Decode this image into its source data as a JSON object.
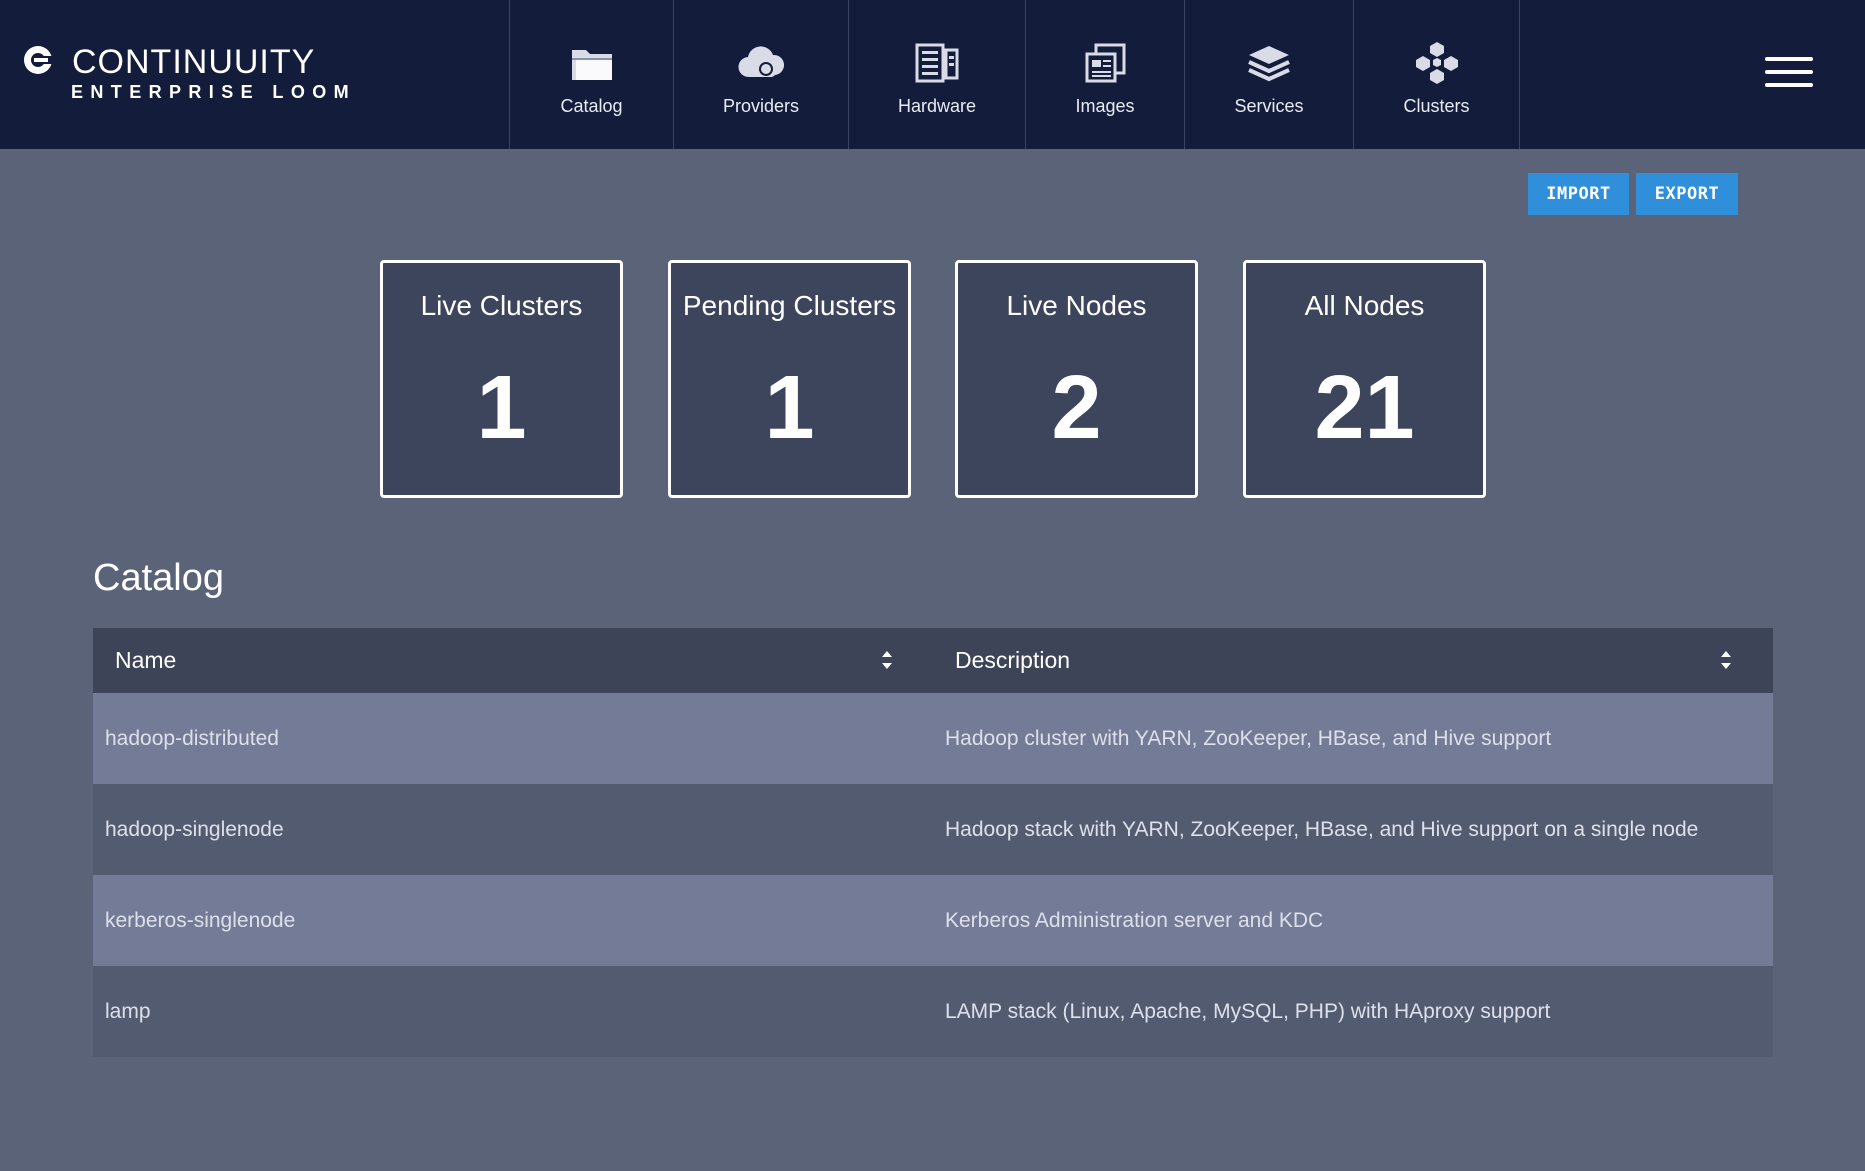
{
  "brand": {
    "name": "CONTINUUITY",
    "subtitle": "ENTERPRISE LOOM"
  },
  "nav": [
    {
      "label": "Catalog",
      "icon": "folder-icon"
    },
    {
      "label": "Providers",
      "icon": "cloud-icon"
    },
    {
      "label": "Hardware",
      "icon": "server-icon"
    },
    {
      "label": "Images",
      "icon": "images-icon"
    },
    {
      "label": "Services",
      "icon": "layers-icon"
    },
    {
      "label": "Clusters",
      "icon": "cubes-icon"
    }
  ],
  "menu": {
    "icon": "hamburger-menu-icon"
  },
  "actions": {
    "import_label": "IMPORT",
    "export_label": "EXPORT"
  },
  "stats": [
    {
      "title": "Live Clusters",
      "value": "1"
    },
    {
      "title": "Pending Clusters",
      "value": "1"
    },
    {
      "title": "Live Nodes",
      "value": "2"
    },
    {
      "title": "All Nodes",
      "value": "21"
    }
  ],
  "catalog": {
    "title": "Catalog",
    "columns": [
      "Name",
      "Description"
    ],
    "rows": [
      {
        "name": "hadoop-distributed",
        "description": "Hadoop cluster with YARN, ZooKeeper, HBase, and Hive support"
      },
      {
        "name": "hadoop-singlenode",
        "description": "Hadoop stack with YARN, ZooKeeper, HBase, and Hive support on a single node"
      },
      {
        "name": "kerberos-singlenode",
        "description": "Kerberos Administration server and KDC"
      },
      {
        "name": "lamp",
        "description": "LAMP stack (Linux, Apache, MySQL, PHP) with HAproxy support"
      }
    ]
  },
  "colors": {
    "header_bg": "#131d3b",
    "page_bg": "#5b6378",
    "accent": "#2f8fdb",
    "card_bg": "#3d455c"
  }
}
